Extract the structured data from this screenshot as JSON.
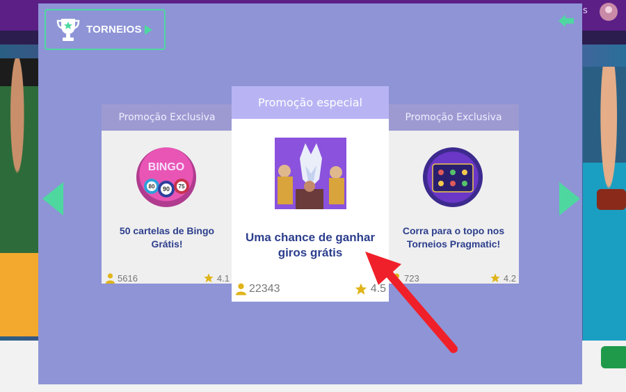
{
  "background": {
    "top_text": "s"
  },
  "modal": {
    "tournaments_button": {
      "label": "TORNEIOS"
    },
    "cards": {
      "left": {
        "header": "Promoção Exclusiva",
        "title": "50 cartelas de Bingo Grátis!",
        "players": "5616",
        "rating": "4.1",
        "thumb_text": "BINGO",
        "ball_numbers": [
          "80",
          "90",
          "75"
        ]
      },
      "main": {
        "header": "Promoção especial",
        "title": "Uma chance de ganhar giros grátis",
        "players": "22343",
        "rating": "4.5"
      },
      "right": {
        "header": "Promoção Exclusiva",
        "title": "Corra para o topo nos Torneios Pragmatic!",
        "players": "723",
        "rating": "4.2"
      }
    }
  },
  "colors": {
    "accent_green": "#4ed8a0",
    "modal_bg": "#8e94d6",
    "card_title": "#2c3e8c",
    "star": "#e0b41a",
    "annotation_arrow": "#f0202a"
  }
}
